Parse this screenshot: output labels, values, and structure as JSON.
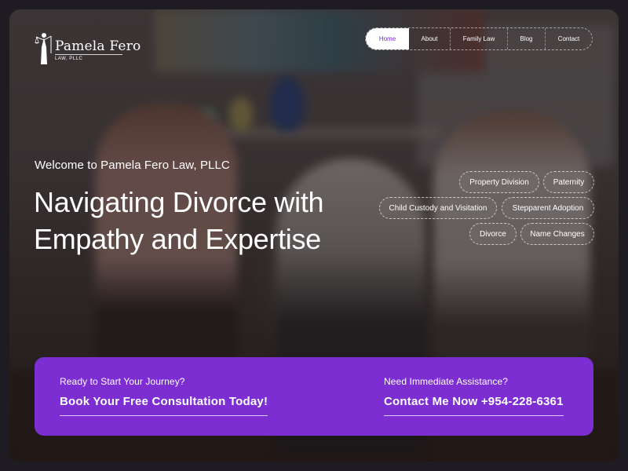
{
  "brand": {
    "name": "Pamela Fero",
    "subtitle": "LAW, PLLC",
    "logo_icon": "lady-justice-icon",
    "accent": "#7d2ed2"
  },
  "nav": {
    "items": [
      {
        "label": "Home",
        "active": true
      },
      {
        "label": "About",
        "active": false
      },
      {
        "label": "Family Law",
        "active": false
      },
      {
        "label": "Blog",
        "active": false
      },
      {
        "label": "Contact",
        "active": false
      }
    ]
  },
  "hero": {
    "welcome": "Welcome to Pamela Fero Law, PLLC",
    "headline": "Navigating Divorce with Empathy and Expertise"
  },
  "tags": [
    "Property Division",
    "Paternity",
    "Child Custody and Visitation",
    "Stepparent Adoption",
    "Divorce",
    "Name Changes"
  ],
  "cta": {
    "left_label": "Ready to Start Your Journey?",
    "left_link": "Book Your Free Consultation Today!",
    "right_label": "Need Immediate Assistance?",
    "right_link": "Contact Me Now +954-228-6361"
  }
}
